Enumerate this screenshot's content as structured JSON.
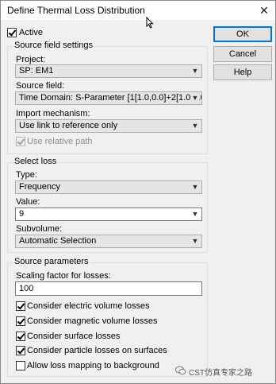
{
  "window": {
    "title": "Define Thermal Loss Distribution",
    "close_glyph": "✕"
  },
  "active": {
    "label": "Active",
    "checked": true
  },
  "buttons": {
    "ok": "OK",
    "cancel": "Cancel",
    "help": "Help"
  },
  "source_field_settings": {
    "title": "Source field settings",
    "project_label": "Project:",
    "project_value": "SP: EM1",
    "source_field_label": "Source field:",
    "source_field_value": "Time Domain: S-Parameter [1[1.0,0.0]+2[1.0,0.0],[",
    "import_label": "Import mechanism:",
    "import_value": "Use link to reference only",
    "relative_path_label": "Use relative path",
    "relative_path_checked": true
  },
  "select_loss": {
    "title": "Select loss",
    "type_label": "Type:",
    "type_value": "Frequency",
    "value_label": "Value:",
    "value_value": "9",
    "subvolume_label": "Subvolume:",
    "subvolume_value": "Automatic Selection"
  },
  "source_parameters": {
    "title": "Source parameters",
    "scaling_label": "Scaling factor for losses:",
    "scaling_value": "100",
    "checkboxes": [
      {
        "label": "Consider electric volume losses",
        "checked": true
      },
      {
        "label": "Consider magnetic volume losses",
        "checked": true
      },
      {
        "label": "Consider surface losses",
        "checked": true
      },
      {
        "label": "Consider particle losses on surfaces",
        "checked": true
      },
      {
        "label": "Allow loss mapping to background",
        "checked": false
      }
    ]
  },
  "watermark": {
    "text": "CST仿真专家之路"
  },
  "icons": {
    "dropdown": "chevron-down-icon",
    "close": "close-icon",
    "cursor": "mouse-pointer-icon"
  }
}
